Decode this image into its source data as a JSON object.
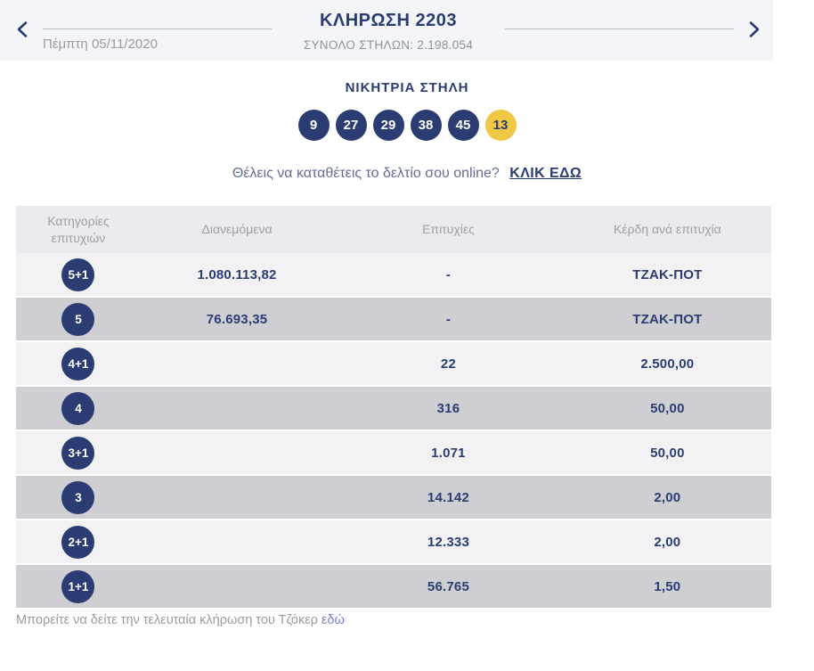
{
  "header": {
    "title": "ΚΛΗΡΩΣΗ 2203",
    "subtitle": "ΣΥΝΟΛΟ ΣΤΗΛΩΝ: 2.198.054",
    "date": "Πέμπτη 05/11/2020"
  },
  "winning": {
    "title": "ΝΙΚΗΤΡΙΑ ΣΤΗΛΗ",
    "numbers": [
      "9",
      "27",
      "29",
      "38",
      "45"
    ],
    "joker": "13"
  },
  "cta": {
    "text": "Θέλεις να καταθέτεις το δελτίο σου online?",
    "link": "ΚΛΙΚ ΕΔΩ"
  },
  "table": {
    "headers": [
      "Κατηγορίες επιτυχιών",
      "Διανεμόμενα",
      "Επιτυχίες",
      "Κέρδη ανά επιτυχία"
    ],
    "rows": [
      {
        "category": "5+1",
        "distributed": "1.080.113,82",
        "winners": "-",
        "prize": "ΤΖΑΚ-ΠΟΤ"
      },
      {
        "category": "5",
        "distributed": "76.693,35",
        "winners": "-",
        "prize": "ΤΖΑΚ-ΠΟΤ"
      },
      {
        "category": "4+1",
        "distributed": "",
        "winners": "22",
        "prize": "2.500,00"
      },
      {
        "category": "4",
        "distributed": "",
        "winners": "316",
        "prize": "50,00"
      },
      {
        "category": "3+1",
        "distributed": "",
        "winners": "1.071",
        "prize": "50,00"
      },
      {
        "category": "3",
        "distributed": "",
        "winners": "14.142",
        "prize": "2,00"
      },
      {
        "category": "2+1",
        "distributed": "",
        "winners": "12.333",
        "prize": "2,00"
      },
      {
        "category": "1+1",
        "distributed": "",
        "winners": "56.765",
        "prize": "1,50"
      }
    ]
  },
  "footer": {
    "text": "Μπορείτε να δείτε την τελευταία κλήρωση του Τζόκερ",
    "link": "εδώ"
  },
  "icons": {
    "prev": "chevron-left",
    "next": "chevron-right"
  },
  "colors": {
    "navy": "#2b3c72",
    "joker_yellow": "#efc845",
    "header_strip_bg": "#f3f5f8",
    "table_header_bg": "#ebebef",
    "row_bg": "#f2f2f4",
    "row_alt_bg": "#ceced3",
    "muted_text": "#9b9b9b",
    "cta_text": "#636e96",
    "footer_link": "#7583c6"
  }
}
